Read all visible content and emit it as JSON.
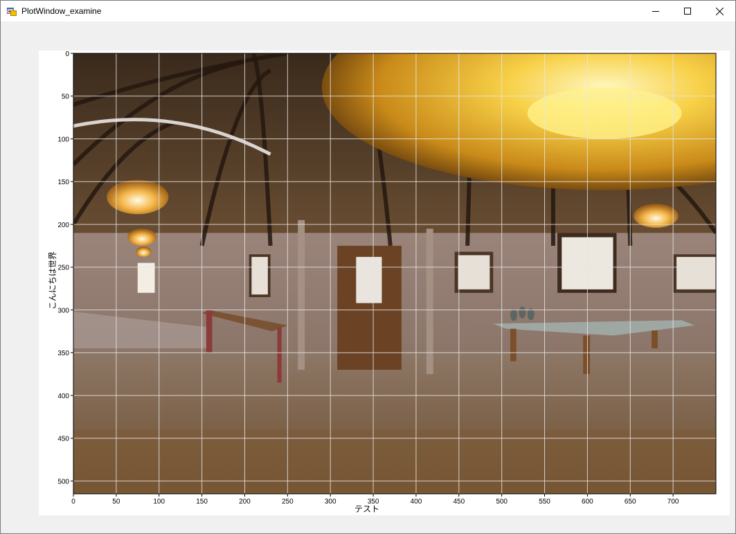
{
  "window": {
    "title": "PlotWindow_examine",
    "icons": {
      "app": "app-window-icon",
      "minimize": "minimize-icon",
      "maximize": "maximize-icon",
      "close": "close-icon"
    }
  },
  "chart_data": {
    "type": "image",
    "xlabel": "テスト",
    "ylabel": "こんにちは世界",
    "xlim": [
      0,
      750
    ],
    "ylim": [
      0,
      515
    ],
    "y_inverted": true,
    "grid": true,
    "x_ticks": [
      0,
      50,
      100,
      150,
      200,
      250,
      300,
      350,
      400,
      450,
      500,
      550,
      600,
      650,
      700
    ],
    "y_ticks": [
      0,
      50,
      100,
      150,
      200,
      250,
      300,
      350,
      400,
      450,
      500
    ],
    "image_description_tag": "panorama-photo"
  }
}
